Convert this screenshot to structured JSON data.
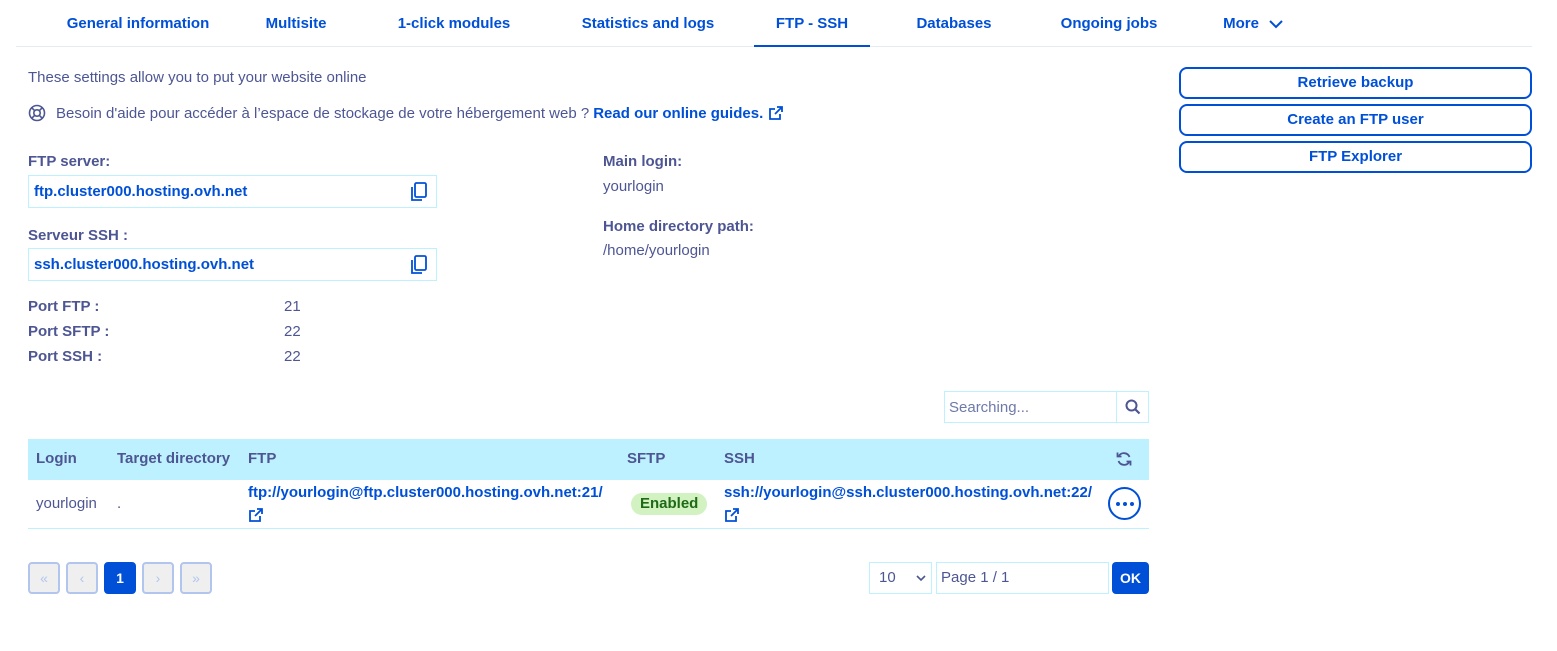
{
  "tabs": [
    {
      "label": "General information"
    },
    {
      "label": "Multisite"
    },
    {
      "label": "1-click modules"
    },
    {
      "label": "Statistics and logs"
    },
    {
      "label": "FTP - SSH"
    },
    {
      "label": "Databases"
    },
    {
      "label": "Ongoing jobs"
    },
    {
      "label": "More"
    }
  ],
  "active_tab": "FTP - SSH",
  "intro": "These settings allow you to put your website online",
  "help": {
    "text": "Besoin d'aide pour accéder à l’espace de stockage de votre hébergement web ?",
    "link": "Read our online guides.",
    "icon": "lifebuoy-icon",
    "link_icon": "external-link-icon"
  },
  "ftp_server": {
    "label": "FTP server:",
    "value": "ftp.cluster000.hosting.ovh.net"
  },
  "ssh_server": {
    "label": "Serveur SSH :",
    "value": "ssh.cluster000.hosting.ovh.net"
  },
  "ports": [
    {
      "label": "Port FTP :",
      "value": "21"
    },
    {
      "label": "Port SFTP :",
      "value": "22"
    },
    {
      "label": "Port SSH :",
      "value": "22"
    }
  ],
  "main_login": {
    "label": "Main login:",
    "value": "yourlogin"
  },
  "home_dir": {
    "label": "Home directory path:",
    "value": "/home/yourlogin"
  },
  "actions": {
    "retrieve_backup": "Retrieve backup",
    "create_ftp_user": "Create an FTP user",
    "ftp_explorer": "FTP Explorer"
  },
  "search": {
    "placeholder": "Searching..."
  },
  "table": {
    "headers": {
      "login": "Login",
      "target": "Target directory",
      "ftp": "FTP",
      "sftp": "SFTP",
      "ssh": "SSH"
    },
    "rows": [
      {
        "login": "yourlogin",
        "target": ".",
        "ftp": "ftp://yourlogin@ftp.cluster000.hosting.ovh.net:21/",
        "sftp": "Enabled",
        "ssh": "ssh://yourlogin@ssh.cluster000.hosting.ovh.net:22/"
      }
    ]
  },
  "pagination": {
    "first": "«",
    "prev": "‹",
    "current": "1",
    "next": "›",
    "last": "»",
    "per_page": "10",
    "page_placeholder": "Page 1 / 1",
    "ok": "OK"
  },
  "colors": {
    "accent": "#0050d7",
    "text": "#4d5693",
    "table_header": "#bef1ff",
    "badge_bg": "#d2f2c2"
  }
}
